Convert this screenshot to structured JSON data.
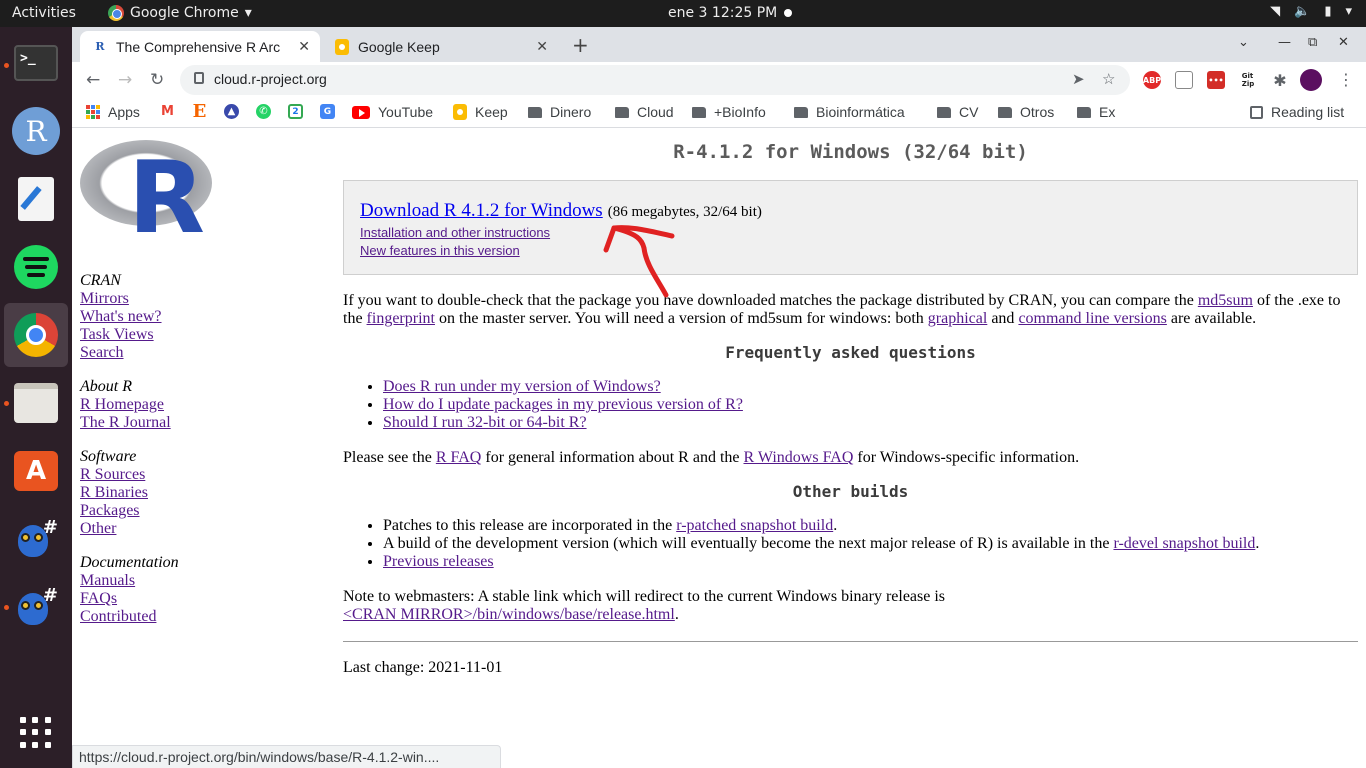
{
  "system": {
    "activities": "Activities",
    "app_menu": "Google Chrome",
    "clock": "ene 3  12:25 PM"
  },
  "browser": {
    "tabs": [
      {
        "title": "The Comprehensive R Arc",
        "active": true
      },
      {
        "title": "Google Keep",
        "active": false
      }
    ],
    "url": "cloud.r-project.org",
    "bookmarks": [
      "Apps",
      "YouTube",
      "Keep",
      "Dinero",
      "Cloud",
      "+BioInfo",
      "Bioinformática",
      "CV",
      "Otros",
      "Ex"
    ],
    "reading_list": "Reading list",
    "status_url": "https://cloud.r-project.org/bin/windows/base/R-4.1.2-win...."
  },
  "sidebar": {
    "groups": [
      {
        "head": "CRAN",
        "links": [
          "Mirrors",
          "What's new?",
          "Task Views",
          "Search"
        ]
      },
      {
        "head": "About R",
        "links": [
          "R Homepage",
          "The R Journal"
        ]
      },
      {
        "head": "Software",
        "links": [
          "R Sources",
          "R Binaries",
          "Packages",
          "Other"
        ]
      },
      {
        "head": "Documentation",
        "links": [
          "Manuals",
          "FAQs",
          "Contributed"
        ]
      }
    ]
  },
  "main": {
    "heading": "R-4.1.2 for Windows (32/64 bit)",
    "download_link": "Download R 4.1.2 for Windows",
    "download_size": "(86 megabytes, 32/64 bit)",
    "install_link": "Installation and other instructions",
    "features_link": "New features in this version",
    "md5": {
      "t1": "If you want to double-check that the package you have downloaded matches the package distributed by CRAN, you can compare the ",
      "link1": "md5sum",
      "t2": " of the .exe to the ",
      "link2": "fingerprint",
      "t3": " on the master server. You will need a version of md5sum for windows: both ",
      "link3": "graphical",
      "t4": " and ",
      "link4": "command line versions",
      "t5": " are available."
    },
    "faq_heading": "Frequently asked questions",
    "faq_items": [
      "Does R run under my version of Windows?",
      "How do I update packages in my previous version of R?",
      "Should I run 32-bit or 64-bit R?"
    ],
    "see": {
      "t1": "Please see the ",
      "link1": "R FAQ",
      "t2": " for general information about R and the ",
      "link2": "R Windows FAQ",
      "t3": " for Windows-specific information."
    },
    "other_heading": "Other builds",
    "other_items": {
      "i1_text": "Patches to this release are incorporated in the ",
      "i1_link": "r-patched snapshot build",
      "i2_text": "A build of the development version (which will eventually become the next major release of R) is available in the ",
      "i2_link": "r-devel snapshot build",
      "i3_link": "Previous releases"
    },
    "note": "Note to webmasters: A stable link which will redirect to the current Windows binary release is",
    "note_link": "<CRAN MIRROR>/bin/windows/base/release.html",
    "last_change": "Last change: 2021-11-01"
  }
}
